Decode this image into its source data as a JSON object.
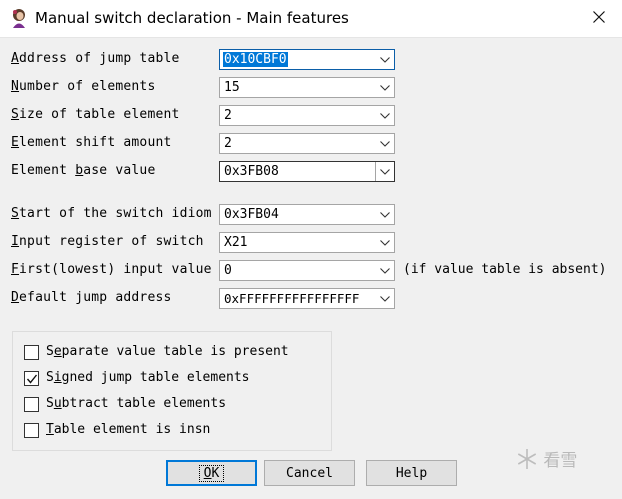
{
  "window": {
    "title": "Manual switch declaration - Main features",
    "accent": "#0078d7"
  },
  "fields": [
    {
      "label_ul": "A",
      "label_rest": "ddress of jump table",
      "value": "0x10CBF0"
    },
    {
      "label_ul": "N",
      "label_rest": "umber of elements",
      "value": "15"
    },
    {
      "label_ul": "S",
      "label_rest": "ize of table element",
      "value": "2"
    },
    {
      "label_ul": "E",
      "label_rest": "lement shift amount",
      "value": "2"
    },
    {
      "label_pre": "Element ",
      "label_ul": "b",
      "label_rest": "ase value",
      "value": "0x3FB08"
    },
    {
      "label_ul": "S",
      "label_rest": "tart of the switch idiom",
      "value": "0x3FB04"
    },
    {
      "label_ul": "I",
      "label_rest": "nput register of switch",
      "value": "X21"
    },
    {
      "label_ul": "F",
      "label_rest": "irst(lowest) input value",
      "value": "0"
    },
    {
      "label_ul": "D",
      "label_rest": "efault jump address",
      "value": "0xFFFFFFFFFFFFFFFF"
    }
  ],
  "first_input_note": "(if value table is absent)",
  "checkboxes": [
    {
      "label_pre": "S",
      "label_ul": "e",
      "label_rest": "parate value table is present",
      "checked": false
    },
    {
      "label_pre": "S",
      "label_ul": "i",
      "label_rest": "gned jump table elements",
      "checked": true
    },
    {
      "label_pre": "S",
      "label_ul": "u",
      "label_rest": "btract table elements",
      "checked": false
    },
    {
      "label_pre": "",
      "label_ul": "T",
      "label_rest": "able element is insn",
      "checked": false
    }
  ],
  "buttons": {
    "ok_ul": "O",
    "ok_rest": "K",
    "cancel": "Cancel",
    "help": "Help"
  },
  "watermark": "看雪"
}
